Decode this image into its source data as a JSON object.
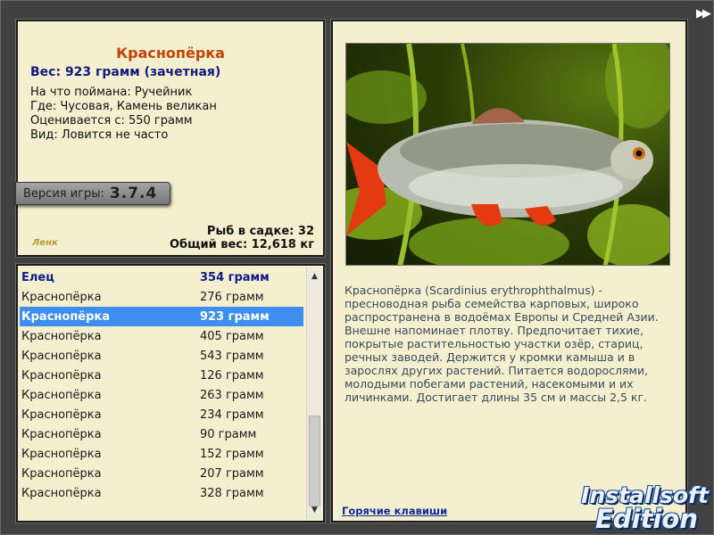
{
  "info": {
    "fish_name": "Краснопёрка",
    "weight_line": "Вес: 923 грамм (зачетная)",
    "bait_line": "На что поймана: Ручейник",
    "place_line": "Где: Чусовая, Камень великан",
    "value_line": "Оценивается с: 550 грамм",
    "kind_line": "Вид: Ловится не часто",
    "version_label": "Версия игры:",
    "version_value": "3.7.4",
    "logo_text": "Ленк",
    "fish_count_line": "Рыб в садке: 32",
    "total_weight_line": "Общий вес: 12,618 кг"
  },
  "catch_list": [
    {
      "name": "Елец",
      "weight": "354 грамм"
    },
    {
      "name": "Краснопёрка",
      "weight": "276 грамм"
    },
    {
      "name": "Краснопёрка",
      "weight": "923 грамм"
    },
    {
      "name": "Краснопёрка",
      "weight": "405 грамм"
    },
    {
      "name": "Краснопёрка",
      "weight": "543 грамм"
    },
    {
      "name": "Краснопёрка",
      "weight": "126 грамм"
    },
    {
      "name": "Краснопёрка",
      "weight": "263 грамм"
    },
    {
      "name": "Краснопёрка",
      "weight": "234 грамм"
    },
    {
      "name": "Краснопёрка",
      "weight": "90 грамм"
    },
    {
      "name": "Краснопёрка",
      "weight": "152 грамм"
    },
    {
      "name": "Краснопёрка",
      "weight": "207 грамм"
    },
    {
      "name": "Краснопёрка",
      "weight": "328 грамм"
    }
  ],
  "description": "Краснопёрка (Scardinius erythrophthalmus) - пресноводная рыба семейства карповых, широко распространена в водоёмах Европы и Средней Азии. Внешне напоминает плотву. Предпочитает тихие, покрытые растительностью участки озёр, стариц, речных заводей. Держится у кромки камыша и в зарослях других растений. Питается водорослями, молодыми побегами растений, насекомыми и их личинками. Достигает длины 35 см и массы 2,5 кг.",
  "hotkeys_label": "Горячие клавиши",
  "watermark": {
    "line1": "Installsoft",
    "line2": "Edition"
  },
  "icons": {
    "fast_forward": "fast-forward-icon",
    "scroll_up": "chevron-up-icon",
    "scroll_down": "chevron-down-icon"
  }
}
